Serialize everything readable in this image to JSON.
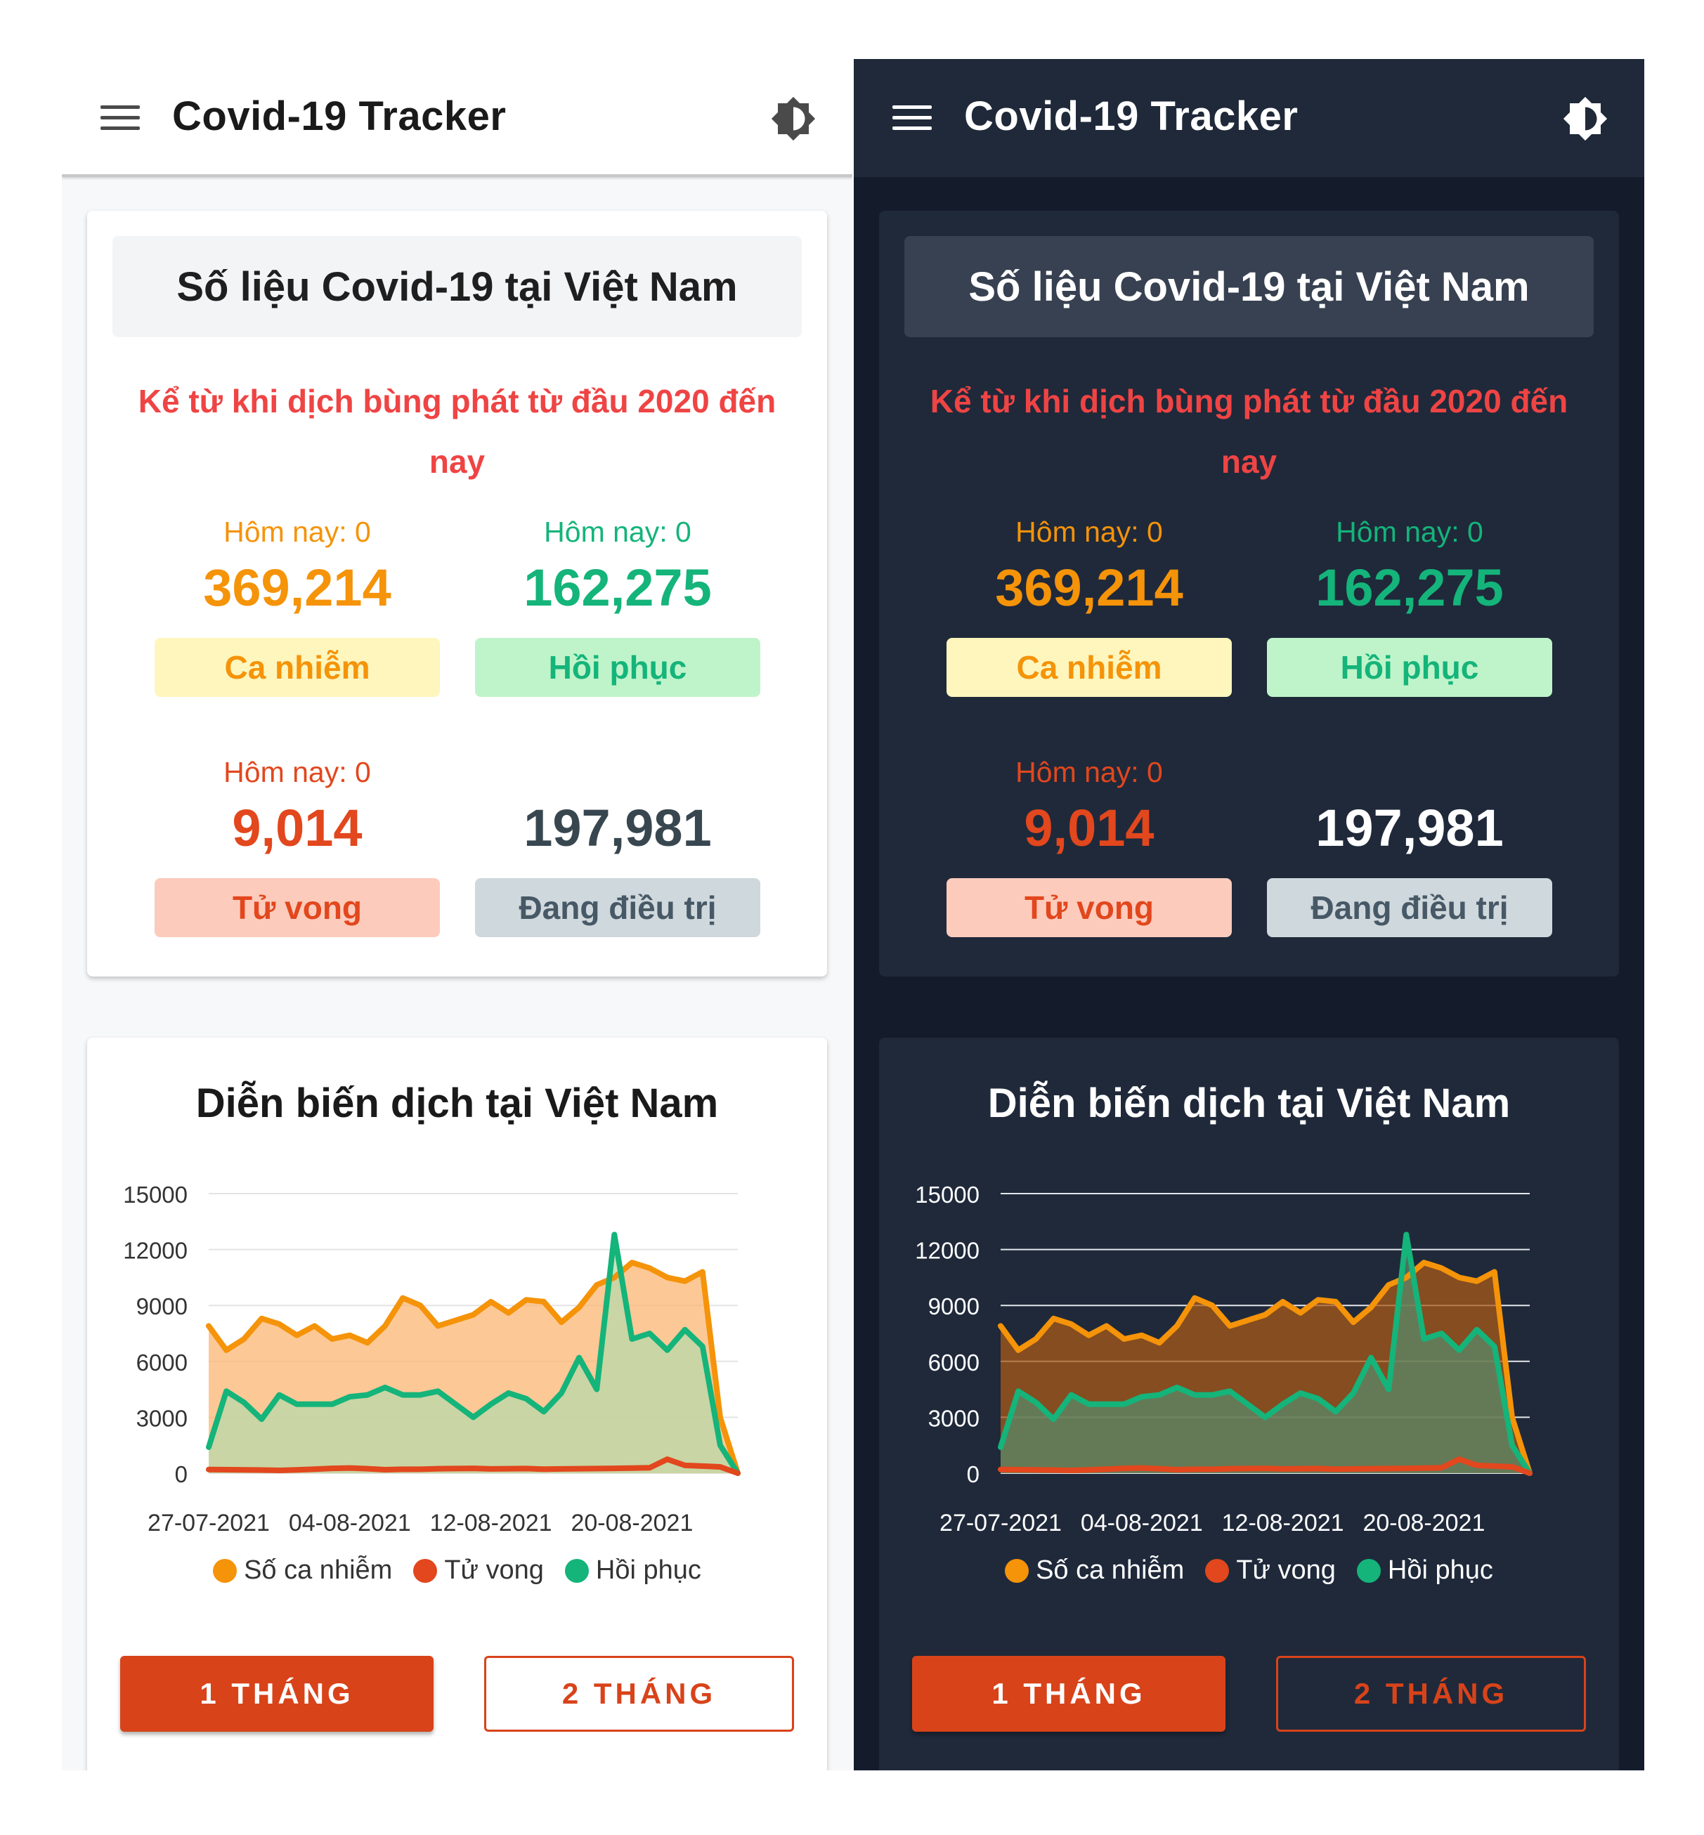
{
  "app": {
    "title": "Covid-19 Tracker"
  },
  "colors": {
    "orange": "#f59309",
    "green": "#14b47a",
    "red": "#e2471d",
    "accent": "#d8431a"
  },
  "stats": {
    "header": "Số liệu Covid-19 tại Việt Nam",
    "since": "Kể từ khi dịch bùng phát từ đầu 2020 đến nay",
    "infected": {
      "today": "Hôm nay: 0",
      "value": "369,214",
      "label": "Ca nhiễm"
    },
    "recovered": {
      "today": "Hôm nay: 0",
      "value": "162,275",
      "label": "Hồi phục"
    },
    "deaths": {
      "today": "Hôm nay: 0",
      "value": "9,014",
      "label": "Tử vong"
    },
    "treating": {
      "value": "197,981",
      "label": "Đang điều trị"
    }
  },
  "chart_card": {
    "title": "Diễn biến dịch tại Việt Nam",
    "buttons": {
      "one_month": "1 THÁNG",
      "two_months": "2 THÁNG"
    }
  },
  "chart_data": {
    "type": "area",
    "title": "Diễn biến dịch tại Việt Nam",
    "xlabel": "",
    "ylabel": "",
    "ylim": [
      0,
      15000
    ],
    "yticks": [
      15000,
      12000,
      9000,
      6000,
      3000,
      0
    ],
    "xtick_labels": [
      "27-07-2021",
      "04-08-2021",
      "12-08-2021",
      "20-08-2021"
    ],
    "xtick_indices": [
      0,
      8,
      16,
      24
    ],
    "grid": true,
    "legend_position": "bottom",
    "x": [
      "27-07-2021",
      "28-07-2021",
      "29-07-2021",
      "30-07-2021",
      "31-07-2021",
      "01-08-2021",
      "02-08-2021",
      "03-08-2021",
      "04-08-2021",
      "05-08-2021",
      "06-08-2021",
      "07-08-2021",
      "08-08-2021",
      "09-08-2021",
      "10-08-2021",
      "11-08-2021",
      "12-08-2021",
      "13-08-2021",
      "14-08-2021",
      "15-08-2021",
      "16-08-2021",
      "17-08-2021",
      "18-08-2021",
      "19-08-2021",
      "20-08-2021",
      "21-08-2021",
      "22-08-2021",
      "23-08-2021",
      "24-08-2021",
      "25-08-2021",
      "26-08-2021"
    ],
    "series": [
      {
        "name": "Số ca nhiễm",
        "color": "#f59309",
        "values": [
          7900,
          6600,
          7200,
          8300,
          8000,
          7400,
          7900,
          7200,
          7400,
          7000,
          7900,
          9400,
          9000,
          7900,
          8200,
          8500,
          9200,
          8600,
          9300,
          9200,
          8100,
          8900,
          10100,
          10500,
          11300,
          11000,
          10500,
          10300,
          10800,
          3000,
          0
        ]
      },
      {
        "name": "Tử vong",
        "color": "#e2471d",
        "values": [
          200,
          190,
          180,
          170,
          150,
          180,
          220,
          260,
          280,
          240,
          190,
          210,
          210,
          240,
          250,
          260,
          230,
          240,
          250,
          220,
          230,
          240,
          250,
          260,
          270,
          290,
          750,
          420,
          380,
          340,
          0
        ]
      },
      {
        "name": "Hồi phục",
        "color": "#14b47a",
        "values": [
          1400,
          4400,
          3800,
          2900,
          4200,
          3700,
          3700,
          3700,
          4100,
          4200,
          4600,
          4200,
          4200,
          4400,
          3700,
          3000,
          3700,
          4300,
          4000,
          3300,
          4300,
          6200,
          4500,
          12800,
          7200,
          7500,
          6600,
          7700,
          6800,
          1500,
          0
        ]
      }
    ]
  }
}
